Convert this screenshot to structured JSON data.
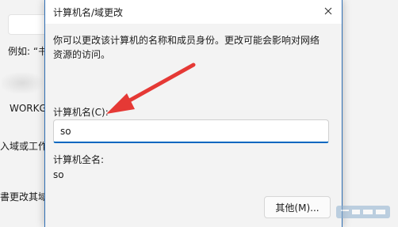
{
  "background": {
    "example_text": "例如: “书",
    "workgroup_text": "WORKG",
    "line1_text": "入域或工作",
    "line2_text": "書更改其域"
  },
  "dialog": {
    "title": "计算机名/域更改",
    "description": "你可以更改该计算机的名称和成员身份。更改可能会影响对网络资源的访问。",
    "computer_name_label": "计算机名(C):",
    "computer_name_value": "so",
    "full_name_label": "计算机全名:",
    "full_name_value": "so",
    "other_button_label": "其他(M)..."
  },
  "icons": {
    "close": "close-icon",
    "annotation": "red-arrow-annotation"
  },
  "colors": {
    "focus_underline": "#0067c0",
    "arrow": "#e53935",
    "dialog_border": "#2f6fb5"
  }
}
